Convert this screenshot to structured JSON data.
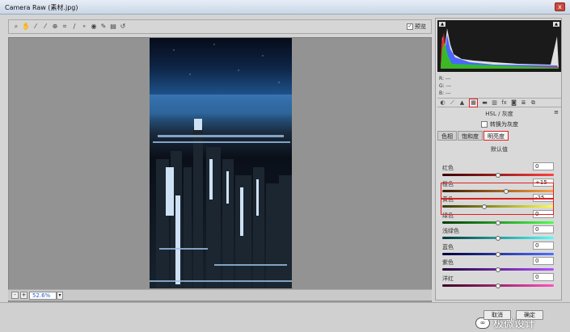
{
  "window": {
    "title": "Camera Raw (素材.jpg)",
    "close_glyph": "x"
  },
  "toolbar": {
    "tools": [
      {
        "icon": "zoom-icon",
        "glyph": "⌕"
      },
      {
        "icon": "hand-icon",
        "glyph": "✋"
      },
      {
        "icon": "white-balance-icon",
        "glyph": "⁄"
      },
      {
        "icon": "color-sampler-icon",
        "glyph": "⁄"
      },
      {
        "icon": "target-adjust-icon",
        "glyph": "⊕"
      },
      {
        "icon": "crop-icon",
        "glyph": "⌗"
      },
      {
        "icon": "straighten-icon",
        "glyph": "∕"
      },
      {
        "icon": "spot-removal-icon",
        "glyph": "∘"
      },
      {
        "icon": "red-eye-icon",
        "glyph": "◉"
      },
      {
        "icon": "adjust-brush-icon",
        "glyph": "✎"
      },
      {
        "icon": "graduated-filter-icon",
        "glyph": "▤"
      },
      {
        "icon": "rotate-icon",
        "glyph": "↺"
      }
    ],
    "preview_label": "预览",
    "preview_checked": true
  },
  "status": {
    "zoom": "52.6%",
    "minus": "-",
    "plus": "+",
    "dropdown": "▾"
  },
  "panel": {
    "histogram_clip_l": "▲",
    "histogram_clip_r": "▲",
    "rgb": {
      "r": "R:  ---",
      "g": "G:  ---",
      "b": "B:  ---"
    },
    "section_title": "HSL / 灰度",
    "menu_icon": "≡",
    "grayscale_label": "转换为灰度",
    "subtabs": [
      "色相",
      "饱和度",
      "明亮度"
    ],
    "active_subtab": 2,
    "default_label": "默认值",
    "sliders": [
      {
        "label": "红色",
        "value": "0",
        "fraction": 0.5,
        "track": "linear-gradient(90deg,#3a0000,#ff4040)"
      },
      {
        "label": "橙色",
        "value": "+15",
        "fraction": 0.575,
        "track": "linear-gradient(90deg,#3a1c00,#ffa040)"
      },
      {
        "label": "黄色",
        "value": "-25",
        "fraction": 0.375,
        "track": "linear-gradient(90deg,#3a3a00,#ffff50)"
      },
      {
        "label": "绿色",
        "value": "0",
        "fraction": 0.5,
        "track": "linear-gradient(90deg,#003a00,#50ff50)"
      },
      {
        "label": "浅绿色",
        "value": "0",
        "fraction": 0.5,
        "track": "linear-gradient(90deg,#003a3a,#50ffff)"
      },
      {
        "label": "蓝色",
        "value": "0",
        "fraction": 0.5,
        "track": "linear-gradient(90deg,#00003a,#5070ff)"
      },
      {
        "label": "紫色",
        "value": "0",
        "fraction": 0.5,
        "track": "linear-gradient(90deg,#22003a,#b050ff)"
      },
      {
        "label": "洋红",
        "value": "0",
        "fraction": 0.5,
        "track": "linear-gradient(90deg,#3a0022,#ff50c0)"
      }
    ]
  },
  "buttons": {
    "cancel": "取消",
    "ok": "确定"
  },
  "watermark": {
    "icon_glyph": "∞",
    "text": "极微设计"
  },
  "colors": {
    "highlight": "#e02020",
    "canvas": "#939393",
    "zoom_text": "#2a58c4"
  }
}
